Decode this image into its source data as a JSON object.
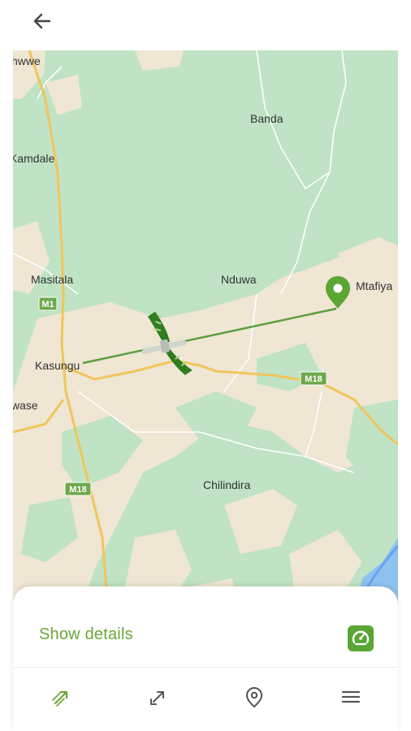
{
  "header": {
    "back_icon": "arrow-left-icon"
  },
  "map": {
    "places": [
      "hwwe",
      "Banda",
      "Kamdale",
      "Masitala",
      "Nduwa",
      "Mtafiya",
      "Kasungu",
      "wase",
      "Chilindira"
    ],
    "roads": [
      "M1",
      "M18",
      "M18",
      "M18"
    ],
    "colors": {
      "land": "#bfe3c4",
      "urban": "#efe6d4",
      "road": "#f2c55c",
      "route": "#5c9e3f",
      "pin": "#5aa534",
      "water": "#6aa3f0"
    },
    "markers": {
      "start": "aircraft-icon",
      "destination": "location-pin-icon"
    }
  },
  "sheet": {
    "show_details_label": "Show details",
    "details_icon": "speedometer-icon"
  },
  "nav": {
    "items": [
      {
        "icon": "route-arrows-icon",
        "active": true
      },
      {
        "icon": "edit-arrow-icon",
        "active": false
      },
      {
        "icon": "map-pin-outline-icon",
        "active": false
      },
      {
        "icon": "hamburger-menu-icon",
        "active": false
      }
    ]
  }
}
